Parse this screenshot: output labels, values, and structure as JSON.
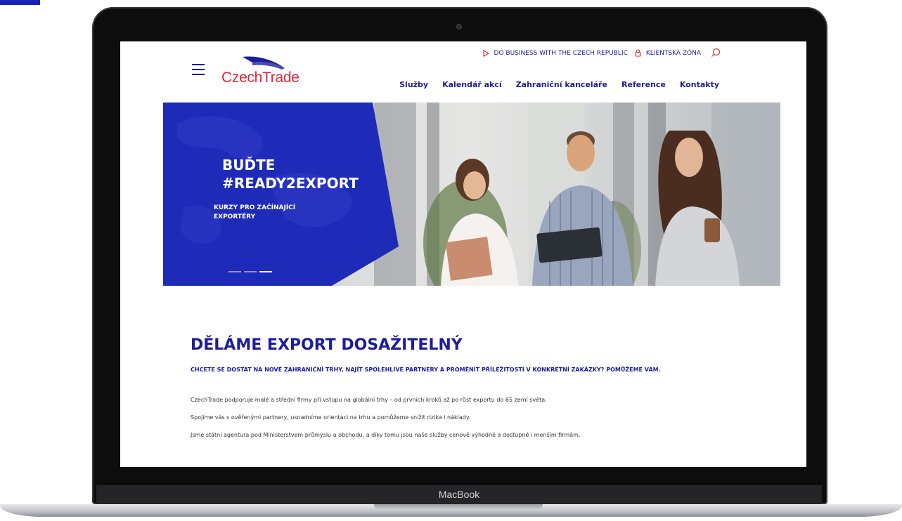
{
  "device": {
    "brand_label": "MacBook"
  },
  "colors": {
    "brand_blue": "#1c1c9e",
    "brand_red": "#e3263b",
    "hero_blue": "#1e2bb8"
  },
  "site": {
    "logo_text": "CzechTrade",
    "top_links": [
      "DO BUSINESS WITH THE CZECH REPUBLIC",
      "KLIENTSKÁ ZÓNA"
    ],
    "nav": [
      "Služby",
      "Kalendář akcí",
      "Zahraniční kanceláře",
      "Reference",
      "Kontakty"
    ]
  },
  "hero": {
    "title_line1": "BUĎTE",
    "title_line2": "#READY2EXPORT",
    "subtitle": "KURZY PRO ZAČÍNAJÍCÍ EXPORTÉRY",
    "slides_total": 3,
    "active_slide": 3
  },
  "content": {
    "headline": "DĚLÁME EXPORT DOSAŽITELNÝ",
    "lead": "CHCETE SE DOSTAT NA NOVÉ ZAHRANIČNÍ TRHY, NAJÍT SPOLEHLIVÉ PARTNERY A PROMĚNIT PŘÍLEŽITOSTI V KONKRÉTNÍ ZAKÁZKY? POMŮŽEME VÁM.",
    "paragraphs": [
      "CzechTrade podporuje malé a střední firmy při vstupu na globální trhy – od prvních kroků až po růst exportu do 65 zemí světa.",
      "Spojíme vás s ověřenými partnery, usnadníme orientaci na trhu a pomůžeme snížit rizika i náklady.",
      "Jsme státní agentura pod Ministerstvem průmyslu a obchodu, a díky tomu jsou naše služby cenově výhodné a dostupné i menším firmám."
    ]
  },
  "icons": [
    "menu-icon",
    "play-triangle-icon",
    "lock-icon",
    "search-icon"
  ]
}
